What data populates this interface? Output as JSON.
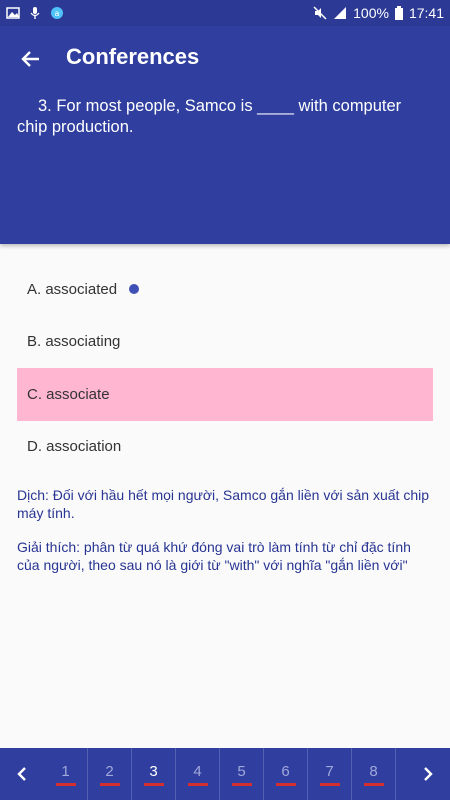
{
  "status_bar": {
    "battery": "100%",
    "time": "17:41"
  },
  "app_bar": {
    "title": "Conferences",
    "question": "3. For most people, Samco is ____ with computer chip production."
  },
  "answers": [
    {
      "label": "A. associated",
      "selected": true
    },
    {
      "label": "B. associating",
      "selected": false
    },
    {
      "label": "C. associate",
      "selected": false,
      "marked_wrong": true
    },
    {
      "label": "D. association",
      "selected": false
    }
  ],
  "explanation": {
    "translation": "Dịch: Đối với hầu hết mọi người, Samco gắn liền với sản xuất chip máy tính.",
    "explanation": "Giải thích: phân từ quá khứ đóng vai trò làm tính từ chỉ đặc tính của người, theo sau nó là giới từ \"with\" với nghĩa \"gắn liền với\""
  },
  "pager": {
    "pages": [
      "1",
      "2",
      "3",
      "4",
      "5",
      "6",
      "7",
      "8"
    ],
    "current": "3"
  },
  "colors": {
    "primary": "#303f9f",
    "wrong_answer_bg": "#ffb6d0",
    "selected_dot": "#3f51b5",
    "answered_underline": "#d32f2f"
  }
}
